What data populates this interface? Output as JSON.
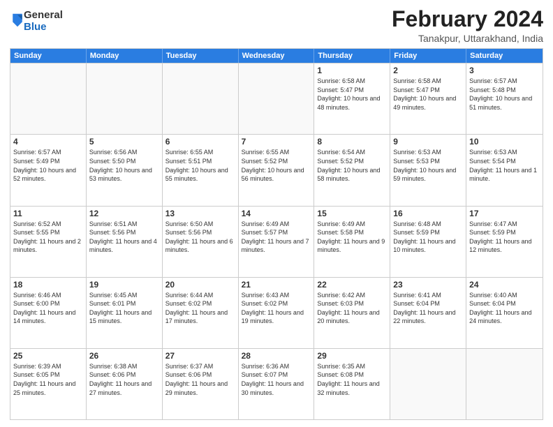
{
  "logo": {
    "general": "General",
    "blue": "Blue"
  },
  "title": "February 2024",
  "location": "Tanakpur, Uttarakhand, India",
  "days_of_week": [
    "Sunday",
    "Monday",
    "Tuesday",
    "Wednesday",
    "Thursday",
    "Friday",
    "Saturday"
  ],
  "weeks": [
    [
      {
        "day": "",
        "sunrise": "",
        "sunset": "",
        "daylight": ""
      },
      {
        "day": "",
        "sunrise": "",
        "sunset": "",
        "daylight": ""
      },
      {
        "day": "",
        "sunrise": "",
        "sunset": "",
        "daylight": ""
      },
      {
        "day": "",
        "sunrise": "",
        "sunset": "",
        "daylight": ""
      },
      {
        "day": "1",
        "sunrise": "Sunrise: 6:58 AM",
        "sunset": "Sunset: 5:47 PM",
        "daylight": "Daylight: 10 hours and 48 minutes."
      },
      {
        "day": "2",
        "sunrise": "Sunrise: 6:58 AM",
        "sunset": "Sunset: 5:47 PM",
        "daylight": "Daylight: 10 hours and 49 minutes."
      },
      {
        "day": "3",
        "sunrise": "Sunrise: 6:57 AM",
        "sunset": "Sunset: 5:48 PM",
        "daylight": "Daylight: 10 hours and 51 minutes."
      }
    ],
    [
      {
        "day": "4",
        "sunrise": "Sunrise: 6:57 AM",
        "sunset": "Sunset: 5:49 PM",
        "daylight": "Daylight: 10 hours and 52 minutes."
      },
      {
        "day": "5",
        "sunrise": "Sunrise: 6:56 AM",
        "sunset": "Sunset: 5:50 PM",
        "daylight": "Daylight: 10 hours and 53 minutes."
      },
      {
        "day": "6",
        "sunrise": "Sunrise: 6:55 AM",
        "sunset": "Sunset: 5:51 PM",
        "daylight": "Daylight: 10 hours and 55 minutes."
      },
      {
        "day": "7",
        "sunrise": "Sunrise: 6:55 AM",
        "sunset": "Sunset: 5:52 PM",
        "daylight": "Daylight: 10 hours and 56 minutes."
      },
      {
        "day": "8",
        "sunrise": "Sunrise: 6:54 AM",
        "sunset": "Sunset: 5:52 PM",
        "daylight": "Daylight: 10 hours and 58 minutes."
      },
      {
        "day": "9",
        "sunrise": "Sunrise: 6:53 AM",
        "sunset": "Sunset: 5:53 PM",
        "daylight": "Daylight: 10 hours and 59 minutes."
      },
      {
        "day": "10",
        "sunrise": "Sunrise: 6:53 AM",
        "sunset": "Sunset: 5:54 PM",
        "daylight": "Daylight: 11 hours and 1 minute."
      }
    ],
    [
      {
        "day": "11",
        "sunrise": "Sunrise: 6:52 AM",
        "sunset": "Sunset: 5:55 PM",
        "daylight": "Daylight: 11 hours and 2 minutes."
      },
      {
        "day": "12",
        "sunrise": "Sunrise: 6:51 AM",
        "sunset": "Sunset: 5:56 PM",
        "daylight": "Daylight: 11 hours and 4 minutes."
      },
      {
        "day": "13",
        "sunrise": "Sunrise: 6:50 AM",
        "sunset": "Sunset: 5:56 PM",
        "daylight": "Daylight: 11 hours and 6 minutes."
      },
      {
        "day": "14",
        "sunrise": "Sunrise: 6:49 AM",
        "sunset": "Sunset: 5:57 PM",
        "daylight": "Daylight: 11 hours and 7 minutes."
      },
      {
        "day": "15",
        "sunrise": "Sunrise: 6:49 AM",
        "sunset": "Sunset: 5:58 PM",
        "daylight": "Daylight: 11 hours and 9 minutes."
      },
      {
        "day": "16",
        "sunrise": "Sunrise: 6:48 AM",
        "sunset": "Sunset: 5:59 PM",
        "daylight": "Daylight: 11 hours and 10 minutes."
      },
      {
        "day": "17",
        "sunrise": "Sunrise: 6:47 AM",
        "sunset": "Sunset: 5:59 PM",
        "daylight": "Daylight: 11 hours and 12 minutes."
      }
    ],
    [
      {
        "day": "18",
        "sunrise": "Sunrise: 6:46 AM",
        "sunset": "Sunset: 6:00 PM",
        "daylight": "Daylight: 11 hours and 14 minutes."
      },
      {
        "day": "19",
        "sunrise": "Sunrise: 6:45 AM",
        "sunset": "Sunset: 6:01 PM",
        "daylight": "Daylight: 11 hours and 15 minutes."
      },
      {
        "day": "20",
        "sunrise": "Sunrise: 6:44 AM",
        "sunset": "Sunset: 6:02 PM",
        "daylight": "Daylight: 11 hours and 17 minutes."
      },
      {
        "day": "21",
        "sunrise": "Sunrise: 6:43 AM",
        "sunset": "Sunset: 6:02 PM",
        "daylight": "Daylight: 11 hours and 19 minutes."
      },
      {
        "day": "22",
        "sunrise": "Sunrise: 6:42 AM",
        "sunset": "Sunset: 6:03 PM",
        "daylight": "Daylight: 11 hours and 20 minutes."
      },
      {
        "day": "23",
        "sunrise": "Sunrise: 6:41 AM",
        "sunset": "Sunset: 6:04 PM",
        "daylight": "Daylight: 11 hours and 22 minutes."
      },
      {
        "day": "24",
        "sunrise": "Sunrise: 6:40 AM",
        "sunset": "Sunset: 6:04 PM",
        "daylight": "Daylight: 11 hours and 24 minutes."
      }
    ],
    [
      {
        "day": "25",
        "sunrise": "Sunrise: 6:39 AM",
        "sunset": "Sunset: 6:05 PM",
        "daylight": "Daylight: 11 hours and 25 minutes."
      },
      {
        "day": "26",
        "sunrise": "Sunrise: 6:38 AM",
        "sunset": "Sunset: 6:06 PM",
        "daylight": "Daylight: 11 hours and 27 minutes."
      },
      {
        "day": "27",
        "sunrise": "Sunrise: 6:37 AM",
        "sunset": "Sunset: 6:06 PM",
        "daylight": "Daylight: 11 hours and 29 minutes."
      },
      {
        "day": "28",
        "sunrise": "Sunrise: 6:36 AM",
        "sunset": "Sunset: 6:07 PM",
        "daylight": "Daylight: 11 hours and 30 minutes."
      },
      {
        "day": "29",
        "sunrise": "Sunrise: 6:35 AM",
        "sunset": "Sunset: 6:08 PM",
        "daylight": "Daylight: 11 hours and 32 minutes."
      },
      {
        "day": "",
        "sunrise": "",
        "sunset": "",
        "daylight": ""
      },
      {
        "day": "",
        "sunrise": "",
        "sunset": "",
        "daylight": ""
      }
    ]
  ]
}
